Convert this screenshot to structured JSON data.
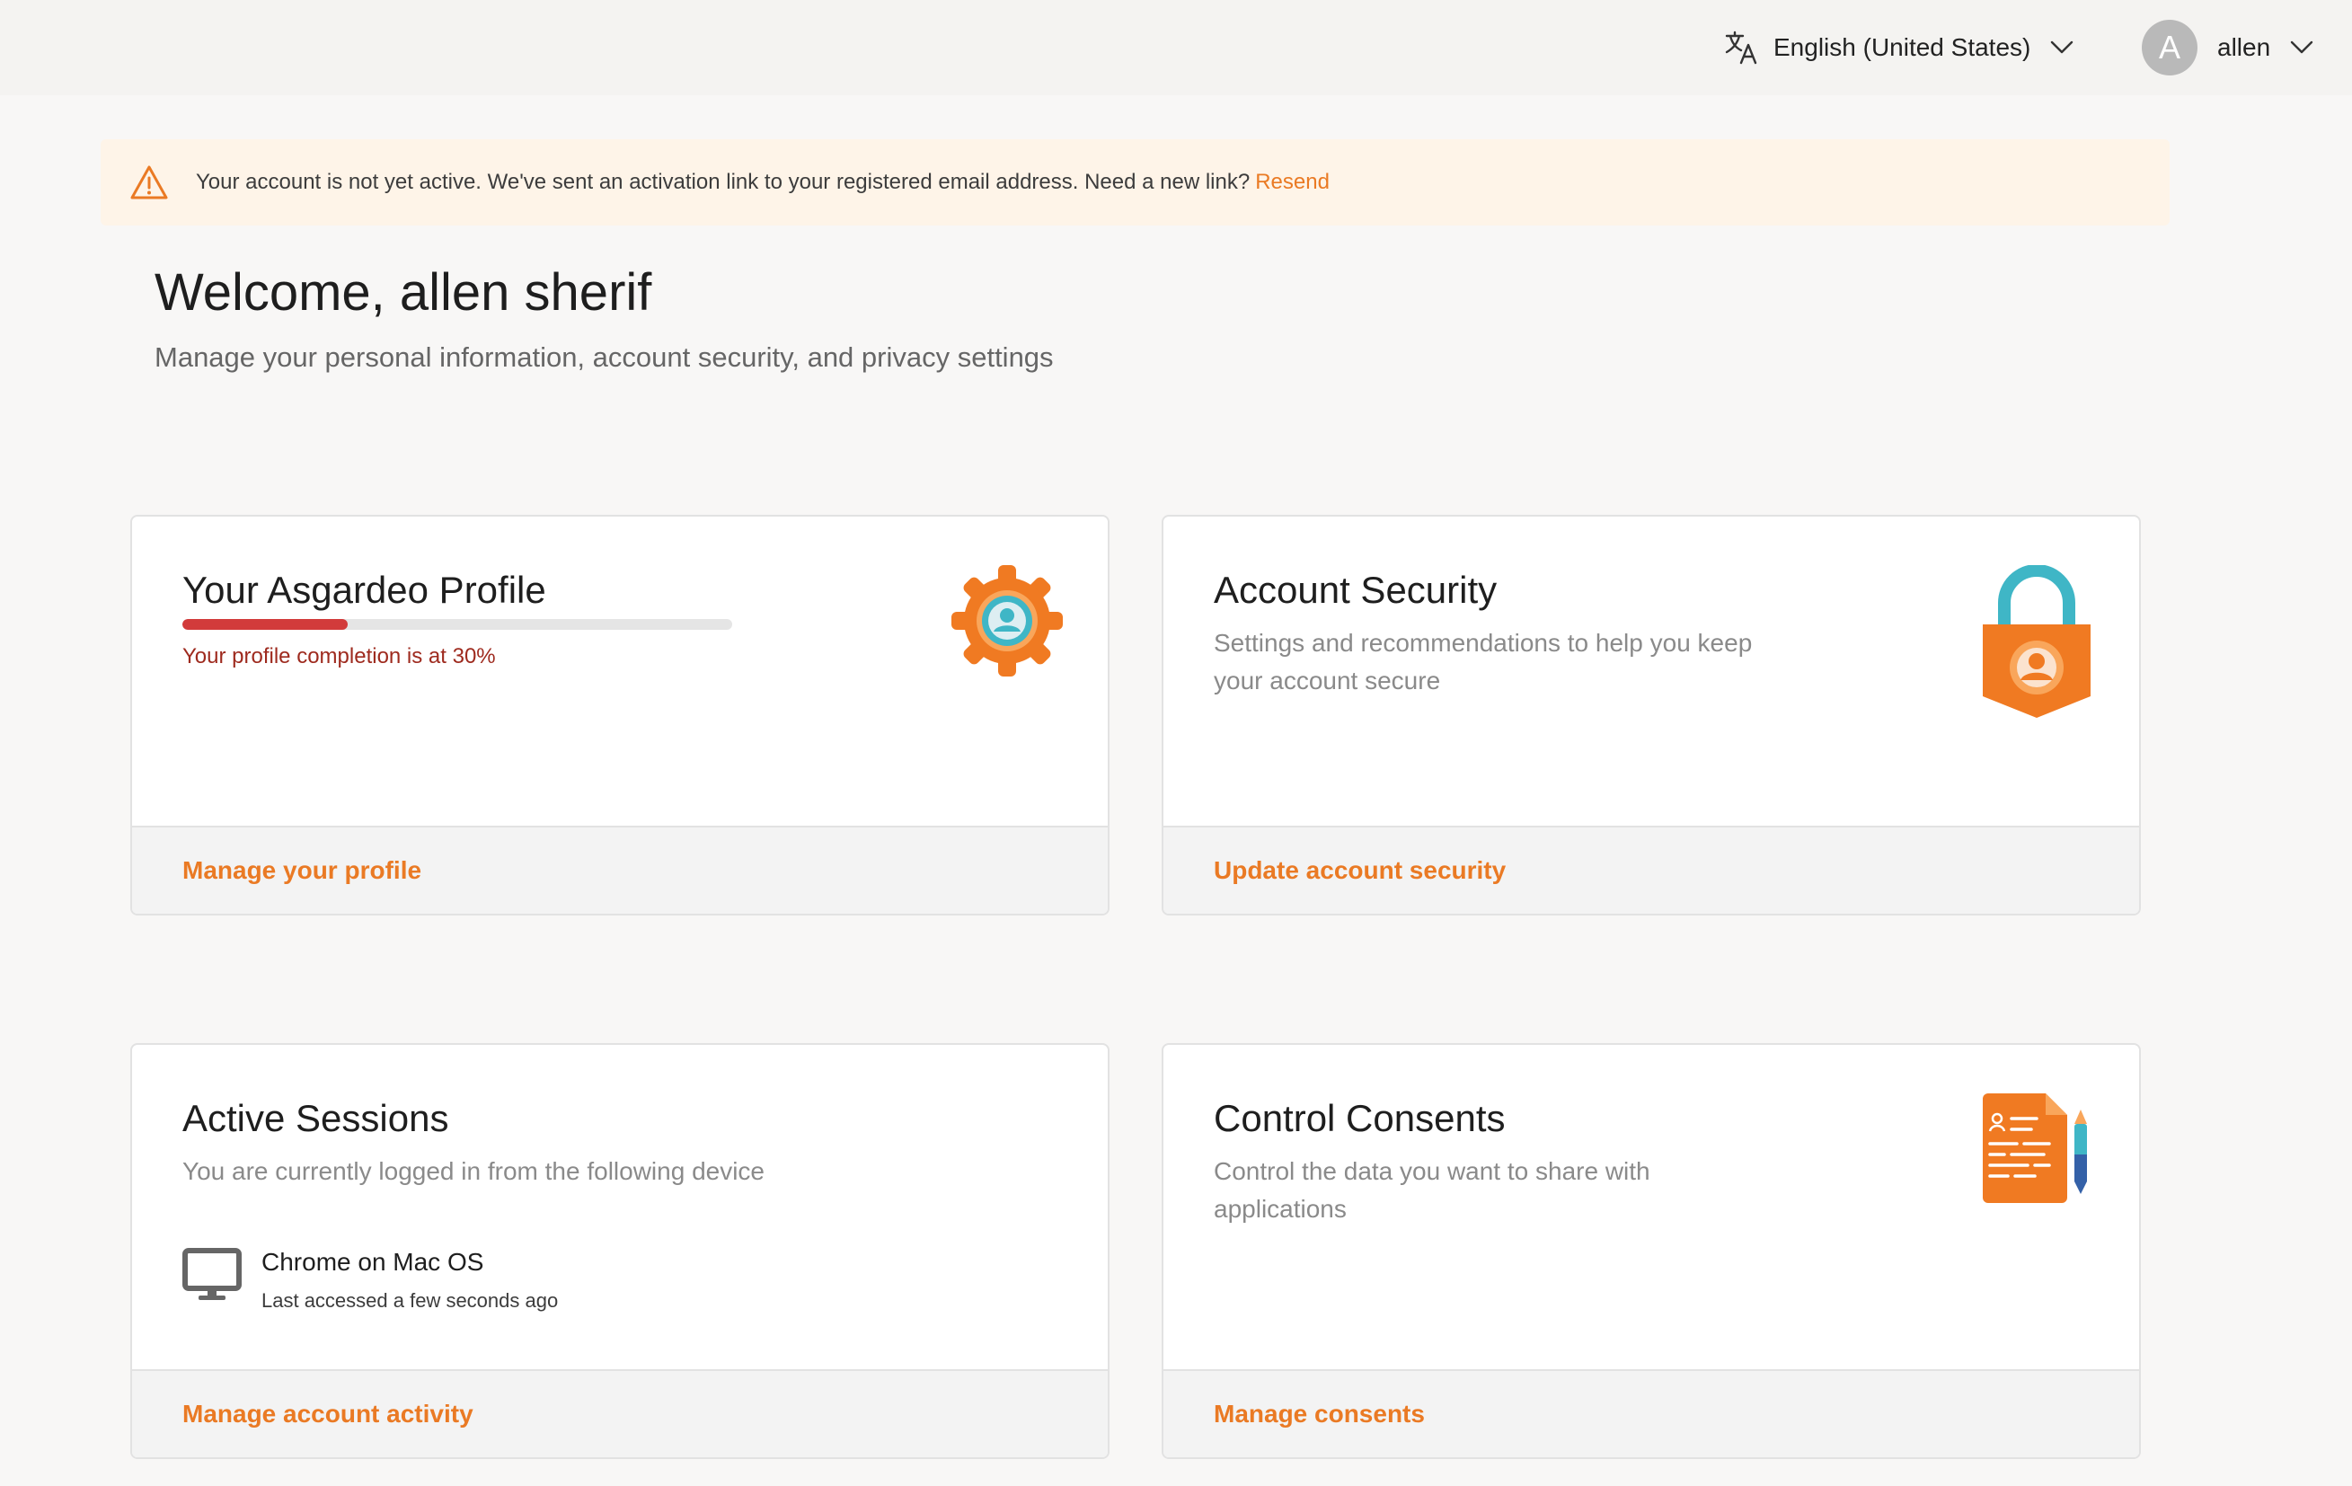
{
  "header": {
    "language": {
      "label": "English (United States)",
      "icon": "translate-icon"
    },
    "user": {
      "initial": "A",
      "name": "allen"
    }
  },
  "alert": {
    "message": "Your account is not yet active. We've sent an activation link to your registered email address. Need a new link?",
    "link_label": "Resend"
  },
  "welcome": {
    "title": "Welcome, allen sherif",
    "subtitle": "Manage your personal information, account security, and privacy settings"
  },
  "cards": {
    "profile": {
      "title": "Your Asgardeo Profile",
      "completion_text": "Your profile completion is at 30%",
      "completion_fraction": 0.3,
      "link_label": "Manage your profile"
    },
    "security": {
      "title": "Account Security",
      "description": "Settings and recommendations to help you keep your account secure",
      "link_label": "Update account security"
    },
    "sessions": {
      "title": "Active Sessions",
      "description": "You are currently logged in from the following device",
      "device_name": "Chrome on Mac OS",
      "device_last_accessed": "Last accessed a few seconds ago",
      "link_label": "Manage account activity"
    },
    "consents": {
      "title": "Control Consents",
      "description": "Control the data you want to share with applications",
      "link_label": "Manage consents"
    }
  },
  "colors": {
    "accent": "#ea7a24",
    "progress": "#d23b3b",
    "alert_bg": "#fef4e8"
  }
}
